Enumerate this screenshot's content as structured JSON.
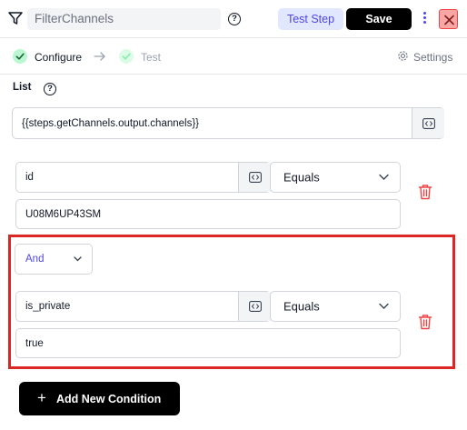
{
  "header": {
    "title_value": "FilterChannels",
    "help_glyph": "?",
    "test_step_label": "Test Step",
    "save_label": "Save",
    "icons": [
      "filter-icon",
      "help-icon",
      "more-vertical-icon",
      "close-icon"
    ]
  },
  "tabs": [
    {
      "label": "Configure",
      "state": "active",
      "icon": "check-circle-icon"
    },
    {
      "label": "Test",
      "state": "inactive",
      "icon": "check-circle-icon"
    }
  ],
  "settings_label": "Settings",
  "list": {
    "label": "List",
    "help_glyph": "?",
    "value": "{{steps.getChannels.output.channels}}"
  },
  "conditions": [
    {
      "field": "id",
      "operator": "Equals",
      "value": "U08M6UP43SM"
    },
    {
      "connector": "And",
      "field": "is_private",
      "operator": "Equals",
      "value": "true",
      "highlighted": true
    }
  ],
  "add_condition_label": "Add New Condition",
  "add_condition_glyph": "+",
  "colors": {
    "accent": "#4f46e5",
    "accent_bg": "#e0e7ff",
    "success": "#22c55e",
    "danger": "#ef4444",
    "highlight": "#dc2626",
    "primary_button": "#000000"
  }
}
